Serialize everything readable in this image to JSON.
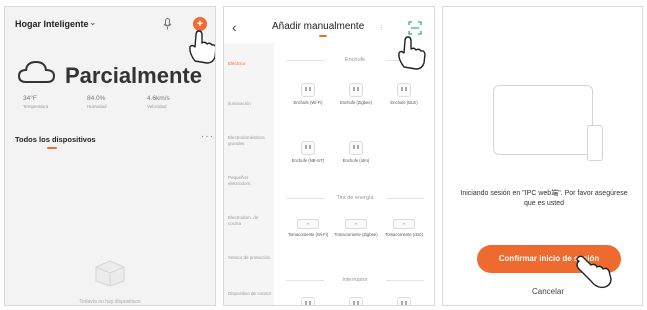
{
  "panel1": {
    "home_title": "Hogar Inteligente",
    "weather": "Parcialmente",
    "stats": [
      {
        "value": "34°F",
        "label": "Temperatura"
      },
      {
        "value": "84.0%",
        "label": "Humedad"
      },
      {
        "value": "4.6km/s",
        "label": "Velocidad"
      }
    ],
    "all_devices": "Todos los dispositivos",
    "more": "···",
    "empty_text": "Todavía no hay dispositivos",
    "accent": "#f26a36"
  },
  "panel2": {
    "title": "Añadir manualmente",
    "separator": "⁝",
    "categories": [
      {
        "label": "Eléctrico",
        "active": true
      },
      {
        "label": "Iluminación",
        "active": false
      },
      {
        "label": "Electrodomésticos grandes",
        "active": false
      },
      {
        "label": "Pequeños electrodom.",
        "active": false
      },
      {
        "label": "Electrodom. de cocina",
        "active": false
      },
      {
        "label": "Sensor de protección",
        "active": false
      },
      {
        "label": "Dispositivo de control",
        "active": false
      }
    ],
    "section_enchufe": "Enchufe",
    "enchufes": [
      {
        "label": "Enchufe (Wi-Fi)"
      },
      {
        "label": "Enchufe (Zigbee)"
      },
      {
        "label": "Enchufe (BLE)"
      },
      {
        "label": "Enchufe (NB-IoT)"
      },
      {
        "label": "Enchufe (otro)"
      }
    ],
    "section_tira": "Tira de energía",
    "tiras": [
      {
        "label": "Tomacorriente (Wi-Fi)"
      },
      {
        "label": "Tomacorriente (Zigbee)"
      },
      {
        "label": "Tomacorriente (otro)"
      }
    ],
    "section_interruptor": "Interruptor"
  },
  "panel3": {
    "login_text": "Iniciando sesión en \"IPC web端\". Por favor asegúrese que es usted",
    "confirm_label": "Confirmar inicio de sesión",
    "cancel_label": "Cancelar",
    "button_color": "#ef6a2f"
  }
}
